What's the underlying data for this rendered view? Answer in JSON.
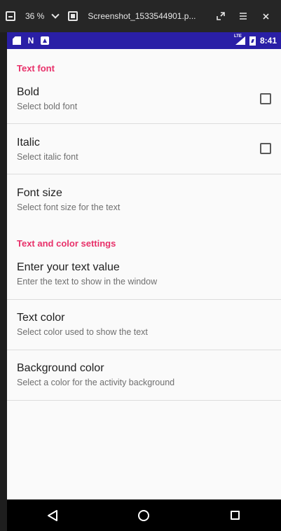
{
  "viewer": {
    "zoom": "36 %",
    "title": "Screenshot_1533544901.p..."
  },
  "status_bar": {
    "network": "LTE",
    "time": "8:41"
  },
  "sections": [
    {
      "header": "Text font",
      "items": [
        {
          "title": "Bold",
          "summary": "Select bold font",
          "checkbox": true,
          "checked": false
        },
        {
          "title": "Italic",
          "summary": "Select italic font",
          "checkbox": true,
          "checked": false
        },
        {
          "title": "Font size",
          "summary": "Select font size for the text",
          "checkbox": false
        }
      ]
    },
    {
      "header": "Text and color settings",
      "items": [
        {
          "title": "Enter your text value",
          "summary": "Enter the text to show in the window",
          "checkbox": false
        },
        {
          "title": "Text color",
          "summary": "Select color used to show the text",
          "checkbox": false
        },
        {
          "title": "Background color",
          "summary": "Select a color for the activity background",
          "checkbox": false
        }
      ]
    }
  ],
  "colors": {
    "status_bar": "#2a1fa6",
    "accent": "#e8316a",
    "background": "#fafafa"
  },
  "nav_icons": [
    "back-icon",
    "home-icon",
    "recents-icon"
  ]
}
